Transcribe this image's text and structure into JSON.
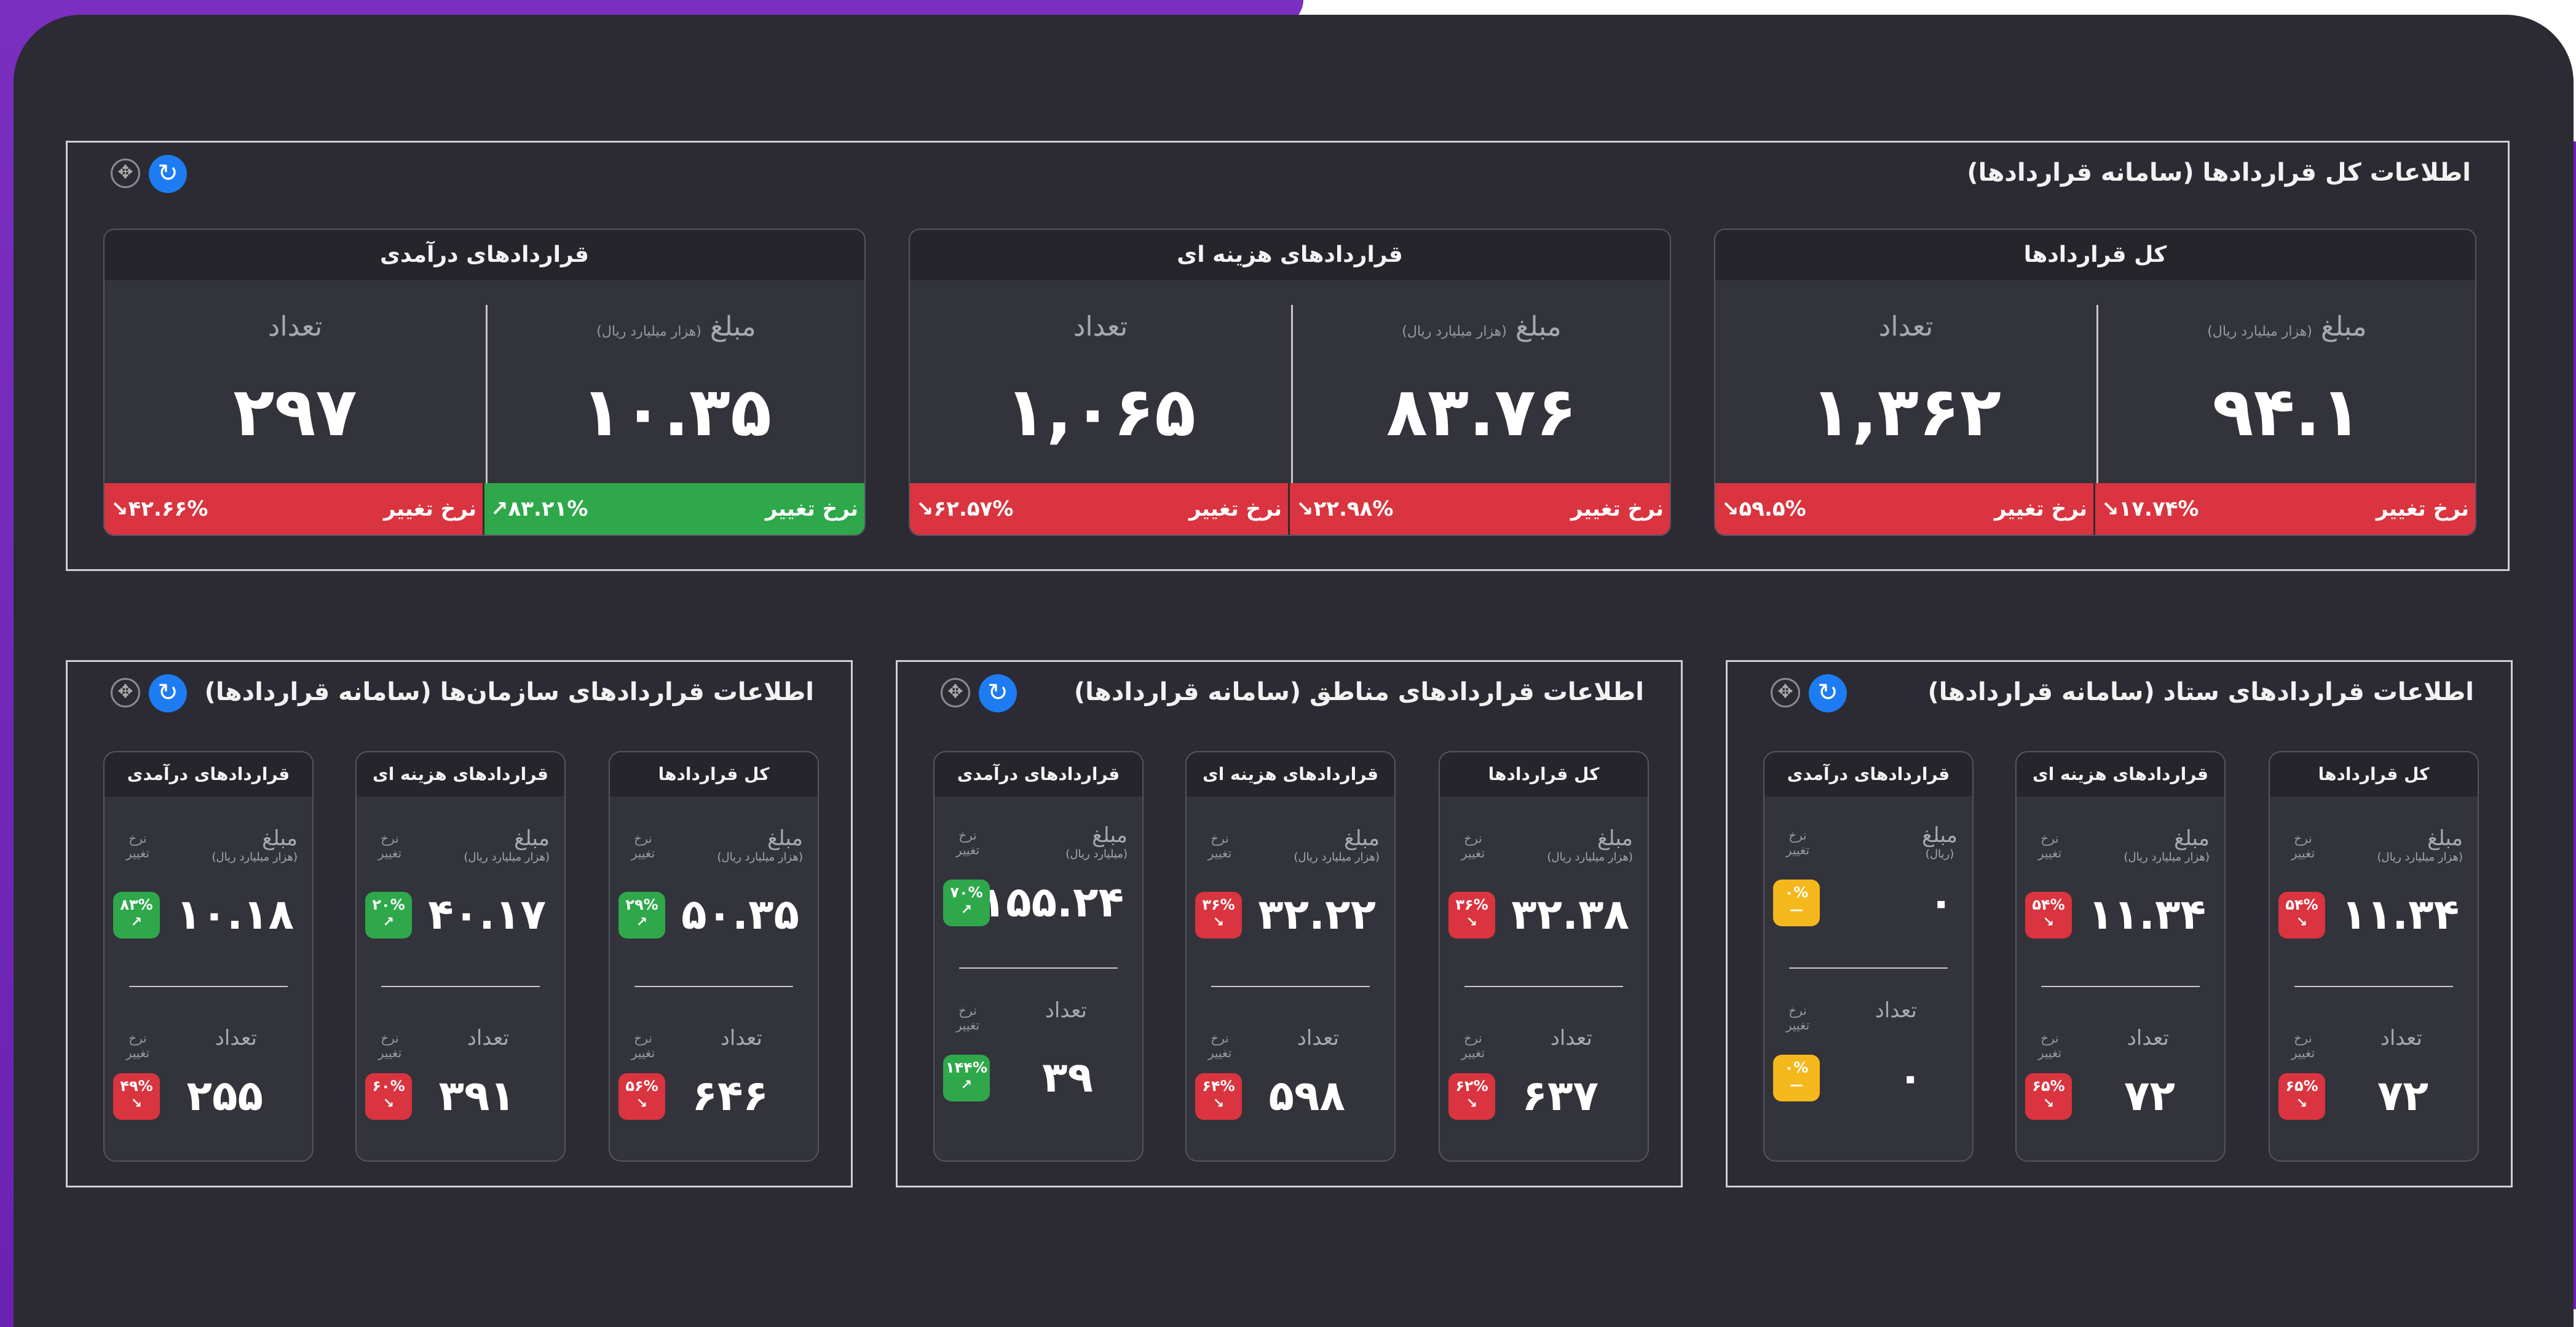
{
  "colors": {
    "panel": "#2c2b33",
    "red": "#d9343f",
    "green": "#2ea84a",
    "yellow": "#f4b81c",
    "accent": "#1e7cf2"
  },
  "top": {
    "title": "اطلاعات کل قراردادها (سامانه قراردادها)",
    "cards": [
      {
        "title": "قراردادهای درآمدی",
        "amount_label": "مبلغ",
        "amount_unit": "(هزار میلیارد ریال)",
        "amount": "۱۰.۳۵",
        "count_label": "تعداد",
        "count": "۲۹۷",
        "rate_label": "نرخ تغییر",
        "amount_rate": "۸۳.۲۱%",
        "count_rate": "۴۲.۶۶%",
        "amount_trend": "up",
        "count_trend": "down"
      },
      {
        "title": "قراردادهای هزینه ای",
        "amount_label": "مبلغ",
        "amount_unit": "(هزار میلیارد ریال)",
        "amount": "۸۳.۷۶",
        "count_label": "تعداد",
        "count": "۱,۰۶۵",
        "rate_label": "نرخ تغییر",
        "amount_rate": "۲۲.۹۸%",
        "count_rate": "۶۲.۵۷%",
        "amount_trend": "down",
        "count_trend": "down"
      },
      {
        "title": "کل قراردادها",
        "amount_label": "مبلغ",
        "amount_unit": "(هزار میلیارد ریال)",
        "amount": "۹۴.۱",
        "count_label": "تعداد",
        "count": "۱,۳۶۲",
        "rate_label": "نرخ تغییر",
        "amount_rate": "۱۷.۷۴%",
        "count_rate": "۵۹.۵%",
        "amount_trend": "down",
        "count_trend": "down"
      }
    ]
  },
  "bottom": [
    {
      "title": "اطلاعات قراردادهای سازمان‌ها (سامانه قراردادها)",
      "cards": [
        {
          "title": "قراردادهای درآمدی",
          "amount_label": "مبلغ",
          "amount_unit": "(هزار میلیارد ریال)",
          "amount": "۱۰.۱۸",
          "amount_rate": "۸۳%",
          "amount_color": "green",
          "count_label": "تعداد",
          "count": "۲۵۵",
          "count_rate": "۴۹%",
          "count_color": "red"
        },
        {
          "title": "قراردادهای هزینه ای",
          "amount_label": "مبلغ",
          "amount_unit": "(هزار میلیارد ریال)",
          "amount": "۴۰.۱۷",
          "amount_rate": "۲۰%",
          "amount_color": "green",
          "count_label": "تعداد",
          "count": "۳۹۱",
          "count_rate": "۶۰%",
          "count_color": "red"
        },
        {
          "title": "کل قراردادها",
          "amount_label": "مبلغ",
          "amount_unit": "(هزار میلیارد ریال)",
          "amount": "۵۰.۳۵",
          "amount_rate": "۲۹%",
          "amount_color": "green",
          "count_label": "تعداد",
          "count": "۶۴۶",
          "count_rate": "۵۶%",
          "count_color": "red"
        }
      ]
    },
    {
      "title": "اطلاعات قراردادهای مناطق (سامانه قراردادها)",
      "cards": [
        {
          "title": "قراردادهای درآمدی",
          "amount_label": "مبلغ",
          "amount_unit": "(میلیارد ریال)",
          "amount": "۱۵۵.۲۴",
          "amount_rate": "۷۰%",
          "amount_color": "green",
          "count_label": "تعداد",
          "count": "۳۹",
          "count_rate": "۱۴۴%",
          "count_color": "green"
        },
        {
          "title": "قراردادهای هزینه ای",
          "amount_label": "مبلغ",
          "amount_unit": "(هزار میلیارد ریال)",
          "amount": "۳۲.۲۲",
          "amount_rate": "۳۶%",
          "amount_color": "red",
          "count_label": "تعداد",
          "count": "۵۹۸",
          "count_rate": "۶۴%",
          "count_color": "red"
        },
        {
          "title": "کل قراردادها",
          "amount_label": "مبلغ",
          "amount_unit": "(هزار میلیارد ریال)",
          "amount": "۳۲.۳۸",
          "amount_rate": "۳۶%",
          "amount_color": "red",
          "count_label": "تعداد",
          "count": "۶۳۷",
          "count_rate": "۶۲%",
          "count_color": "red"
        }
      ]
    },
    {
      "title": "اطلاعات قراردادهای ستاد (سامانه قراردادها)",
      "cards": [
        {
          "title": "قراردادهای درآمدی",
          "amount_label": "مبلغ",
          "amount_unit": "(ریال)",
          "amount": "۰",
          "amount_rate": "۰%",
          "amount_color": "yellow",
          "count_label": "تعداد",
          "count": "۰",
          "count_rate": "۰%",
          "count_color": "yellow"
        },
        {
          "title": "قراردادهای هزینه ای",
          "amount_label": "مبلغ",
          "amount_unit": "(هزار میلیارد ریال)",
          "amount": "۱۱.۳۴",
          "amount_rate": "۵۴%",
          "amount_color": "red",
          "count_label": "تعداد",
          "count": "۷۲",
          "count_rate": "۶۵%",
          "count_color": "red"
        },
        {
          "title": "کل قراردادها",
          "amount_label": "مبلغ",
          "amount_unit": "(هزار میلیارد ریال)",
          "amount": "۱۱.۳۴",
          "amount_rate": "۵۴%",
          "amount_color": "red",
          "count_label": "تعداد",
          "count": "۷۲",
          "count_rate": "۶۵%",
          "count_color": "red"
        }
      ]
    }
  ],
  "rate_label": "نرخ تغییر",
  "icons": {
    "move": "move-icon",
    "refresh": "refresh-icon",
    "trend_up": "trend-up-icon",
    "trend_down": "trend-down-icon"
  }
}
